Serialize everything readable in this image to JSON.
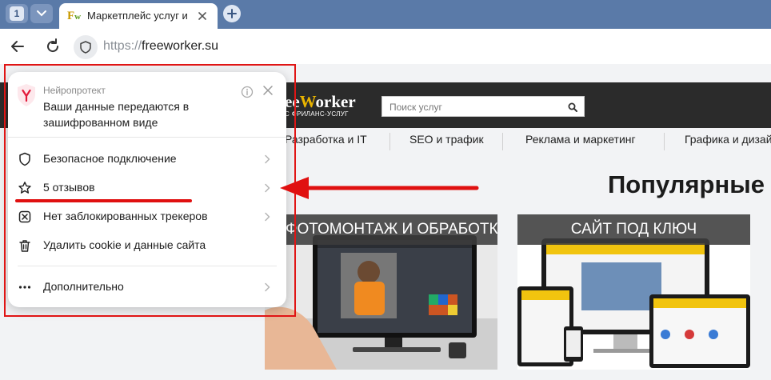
{
  "browser": {
    "tab_count": "1",
    "active_tab_title": "Маркетплейс услуг и б",
    "url_scheme": "https://",
    "url_host": "freeworker.su"
  },
  "popup": {
    "title": "Нейропротект",
    "description": "Ваши данные передаются в зашифрованном виде",
    "items": [
      {
        "label": "Безопасное подключение"
      },
      {
        "label": "5 отзывов"
      },
      {
        "label": "Нет заблокированных трекеров"
      },
      {
        "label": "Удалить cookie и данные сайта"
      },
      {
        "label": "Дополнительно"
      }
    ]
  },
  "site": {
    "logo_text": "eeWorker",
    "tagline": "С ФРИЛАНС-УСЛУГ",
    "search_placeholder": "Поиск услуг",
    "nav": [
      "Разработка и IT",
      "SEO и трафик",
      "Реклама и маркетинг",
      "Графика и дизай"
    ],
    "heading": "Популярные",
    "cards": [
      {
        "title": "ФОТОМОНТАЖ И ОБРАБОТКА"
      },
      {
        "title": "САЙТ ПОД КЛЮЧ"
      }
    ]
  },
  "colors": {
    "tabstrip": "#5a7aa8",
    "highlight_red": "#e01010",
    "site_header": "#2b2b2b",
    "logo_accent": "#e9b400"
  }
}
